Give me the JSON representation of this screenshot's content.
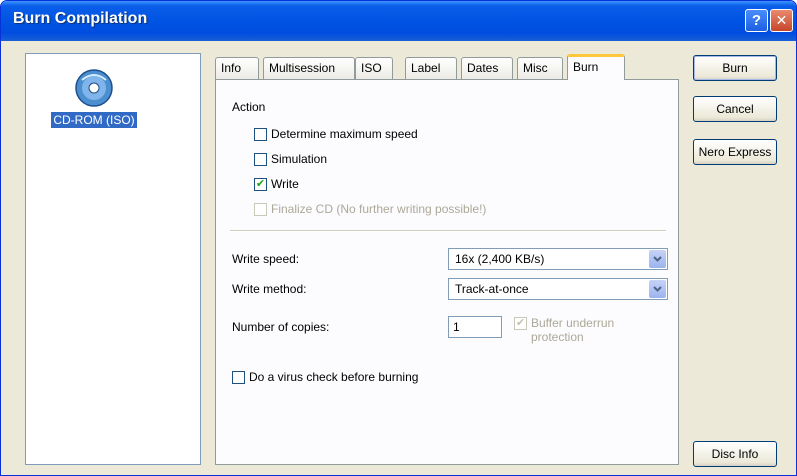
{
  "window": {
    "title": "Burn Compilation",
    "help_label": "?",
    "close_label": "✕"
  },
  "left_pane": {
    "items": [
      {
        "label": "CD-ROM (ISO)",
        "icon": "cd-rom-icon",
        "selected": true
      }
    ]
  },
  "tabs": [
    {
      "label": "Info",
      "active": false
    },
    {
      "label": "Multisession",
      "active": false
    },
    {
      "label": "ISO",
      "active": false
    },
    {
      "label": "Label",
      "active": false
    },
    {
      "label": "Dates",
      "active": false
    },
    {
      "label": "Misc",
      "active": false
    },
    {
      "label": "Burn",
      "active": true
    }
  ],
  "burn_tab": {
    "action_label": "Action",
    "checkboxes": [
      {
        "label": "Determine maximum speed",
        "checked": false,
        "enabled": true
      },
      {
        "label": "Simulation",
        "checked": false,
        "enabled": true
      },
      {
        "label": "Write",
        "checked": true,
        "enabled": true
      },
      {
        "label": "Finalize CD (No further writing possible!)",
        "checked": false,
        "enabled": false
      }
    ],
    "write_speed": {
      "label": "Write speed:",
      "value": "16x (2,400 KB/s)"
    },
    "write_method": {
      "label": "Write method:",
      "value": "Track-at-once"
    },
    "copies": {
      "label": "Number of copies:",
      "value": "1"
    },
    "buffer_underrun": {
      "line1": "Buffer underrun",
      "line2": "protection",
      "checked": true,
      "enabled": false
    },
    "virus_check": {
      "label": "Do a virus check before burning",
      "checked": false
    }
  },
  "buttons": {
    "burn": "Burn",
    "cancel": "Cancel",
    "nero_express": "Nero Express",
    "disc_info": "Disc Info"
  },
  "colors": {
    "titlebar": "#0054e3",
    "selection": "#316ac5",
    "active_tab_accent": "#ffc83c",
    "check_mark": "#21a121"
  }
}
